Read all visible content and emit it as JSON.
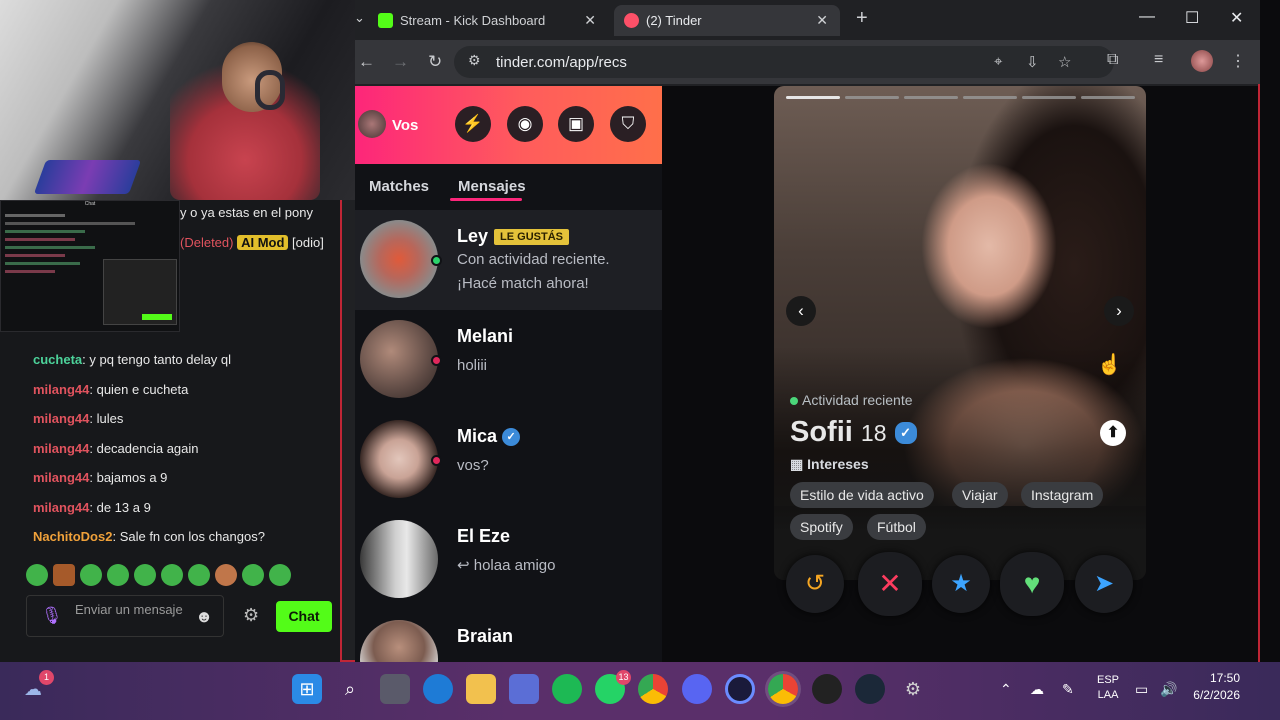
{
  "browser": {
    "tabs": [
      {
        "label": "Stream - Kick Dashboard",
        "favicon_color": "#53fc18"
      },
      {
        "label": "(2) Tinder",
        "favicon_color": "#fd5068"
      }
    ],
    "url": "tinder.com/app/recs"
  },
  "chat": {
    "mini_title": "Chat",
    "messages": [
      {
        "user": "",
        "text": "y o ya estas en el pony",
        "color": "green"
      },
      {
        "user": "(Deleted)",
        "badge": "AI Mod",
        "extra": "[odio]",
        "color": "red"
      },
      {
        "user": "cucheta",
        "text": ": y pq tengo tanto delay ql",
        "color": "green"
      },
      {
        "user": "milang44",
        "text": ": quien e cucheta",
        "color": "red"
      },
      {
        "user": "milang44",
        "text": ": lules",
        "color": "red"
      },
      {
        "user": "milang44",
        "text": ": decadencia again",
        "color": "red"
      },
      {
        "user": "milang44",
        "text": ": bajamos a 9",
        "color": "red"
      },
      {
        "user": "milang44",
        "text": ": de 13 a 9",
        "color": "red"
      },
      {
        "user": "NachitoDos2",
        "text": ": Sale fn con los changos?",
        "color": "orange"
      }
    ],
    "input_placeholder": "Enviar un mensaje",
    "send_label": "Chat"
  },
  "tinder": {
    "me_label": "Vos",
    "tabs": [
      "Matches",
      "Mensajes"
    ],
    "active_tab": "Mensajes",
    "conversations": [
      {
        "name": "Ley",
        "badge": "LE GUSTÁS",
        "message": "Con actividad reciente.",
        "message2": "¡Hacé match ahora!",
        "status": "online"
      },
      {
        "name": "Melani",
        "message": "holiii",
        "status": "unread"
      },
      {
        "name": "Mica",
        "message": "vos?",
        "verified": true,
        "status": "unread"
      },
      {
        "name": "El Eze",
        "message": "↩ holaa amigo"
      },
      {
        "name": "Braian",
        "message": ""
      }
    ],
    "profile": {
      "activity": "Actividad reciente",
      "name": "Sofii",
      "age": "18",
      "verified": true,
      "interests_label": "Intereses",
      "interests": [
        "Estilo de vida activo",
        "Viajar",
        "Instagram",
        "Spotify",
        "Fútbol"
      ],
      "photo_count": 6,
      "current_photo": 1
    },
    "actions": [
      {
        "name": "rewind",
        "icon": "↺",
        "color": "#f5a623"
      },
      {
        "name": "nope",
        "icon": "✕",
        "color": "#fd3c5f"
      },
      {
        "name": "super-like",
        "icon": "★",
        "color": "#3ca4ff"
      },
      {
        "name": "like",
        "icon": "♥",
        "color": "#63e07a"
      },
      {
        "name": "boost",
        "icon": "➤",
        "color": "#3ca4ff"
      }
    ]
  },
  "taskbar": {
    "whatsapp_badge": "13",
    "weather_badge": "1",
    "lang_line1": "ESP",
    "lang_line2": "LAA",
    "time": "17:50",
    "date": "6/2/2026"
  },
  "colors": {
    "kick_green": "#53fc18",
    "tinder_pink": "#fd267a",
    "tinder_orange": "#ff6f4a"
  }
}
